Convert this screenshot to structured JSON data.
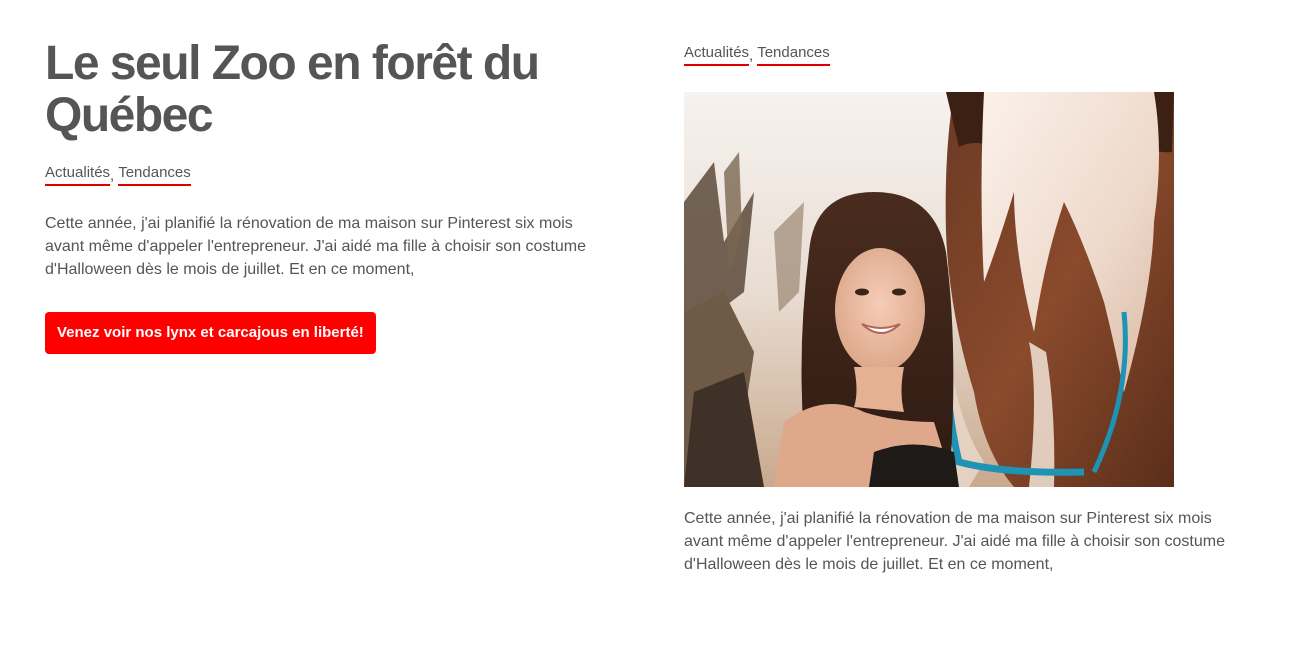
{
  "feature": {
    "title": "Le seul Zoo en forêt du Québec",
    "categories": [
      {
        "label": "Actualités"
      },
      {
        "label": "Tendances"
      }
    ],
    "separator": ",",
    "excerpt": "Cette année, j'ai planifié la rénovation de ma maison sur Pinterest six mois avant même d'appeler l'entrepreneur. J'ai aidé ma fille à choisir son costume d'Halloween dès le mois de juillet. Et en ce moment,",
    "cta_label": "Venez voir nos lynx et carcajous en liberté!"
  },
  "post": {
    "categories": [
      {
        "label": "Actualités"
      },
      {
        "label": "Tendances"
      }
    ],
    "separator": ",",
    "image_icon": "photo-girl-with-horse",
    "excerpt": "Cette année, j'ai planifié la rénovation de ma maison sur Pinterest six mois avant même d'appeler l'entrepreneur. J'ai aidé ma fille à choisir son costume d'Halloween dès le mois de juillet. Et en ce moment,"
  },
  "colors": {
    "accent": "#ff0000",
    "text": "#555555",
    "background": "#ffffff"
  }
}
